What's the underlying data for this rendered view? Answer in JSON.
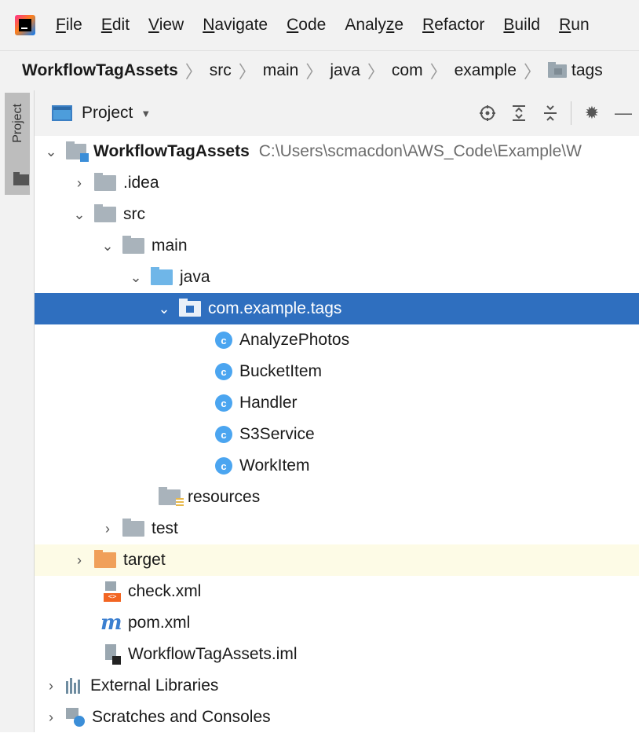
{
  "menu": {
    "items": [
      {
        "label": "File",
        "mnemonic": "F",
        "rest": "ile"
      },
      {
        "label": "Edit",
        "mnemonic": "E",
        "rest": "dit"
      },
      {
        "label": "View",
        "mnemonic": "V",
        "rest": "iew"
      },
      {
        "label": "Navigate",
        "mnemonic": "N",
        "rest": "avigate"
      },
      {
        "label": "Code",
        "mnemonic": "C",
        "rest": "ode"
      },
      {
        "label": "Analyze",
        "pre": "Analy",
        "mnemonic": "z",
        "rest": "e"
      },
      {
        "label": "Refactor",
        "mnemonic": "R",
        "rest": "efactor"
      },
      {
        "label": "Build",
        "mnemonic": "B",
        "rest": "uild"
      },
      {
        "label": "Run",
        "mnemonic": "R",
        "rest": "un"
      }
    ]
  },
  "breadcrumb": [
    "WorkflowTagAssets",
    "src",
    "main",
    "java",
    "com",
    "example",
    "tags"
  ],
  "toolstrip": {
    "project_label": "Project"
  },
  "project_panel": {
    "view_label": "Project",
    "tools": [
      "locate-icon",
      "expand-all-icon",
      "collapse-all-icon",
      "gear-icon",
      "minimize-icon"
    ]
  },
  "tree": {
    "root_name": "WorkflowTagAssets",
    "root_path": "C:\\Users\\scmacdon\\AWS_Code\\Example\\W",
    "idea": ".idea",
    "src": "src",
    "main": "main",
    "java": "java",
    "package": "com.example.tags",
    "classes": [
      "AnalyzePhotos",
      "BucketItem",
      "Handler",
      "S3Service",
      "WorkItem"
    ],
    "class_badge": "c",
    "resources": "resources",
    "test": "test",
    "target": "target",
    "check_xml": "check.xml",
    "pom_xml": "pom.xml",
    "pom_icon": "m",
    "iml": "WorkflowTagAssets.iml",
    "external_libraries": "External Libraries",
    "scratches": "Scratches and Consoles"
  },
  "colors": {
    "selection": "#2f6fbf",
    "excluded_bg": "#fdfbe6",
    "class_icon": "#4ba5f0",
    "maven": "#3b7fd0"
  }
}
